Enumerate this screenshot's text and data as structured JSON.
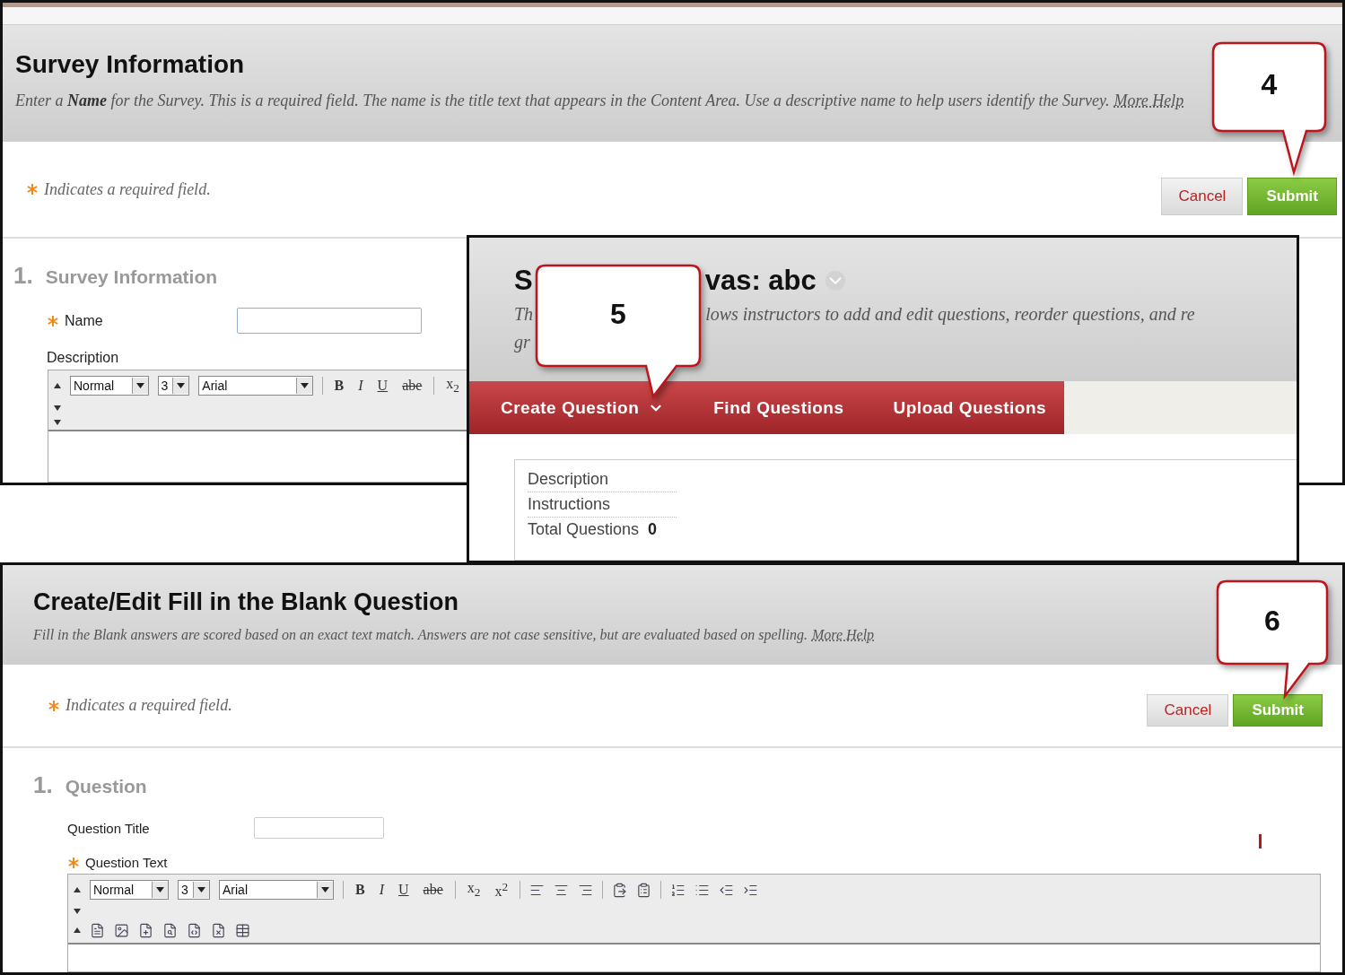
{
  "survey_panel": {
    "title": "Survey Information",
    "description": "Enter a **Name** for the Survey. This is a required field. The name is the title text that appears in the Content Area. Use a descriptive name to help users identify the Survey.",
    "more_help": "More Help",
    "callout": "4",
    "required_note": "Indicates a required field.",
    "buttons": [
      {
        "label": "Cancel",
        "kind": "cancel"
      },
      {
        "label": "Submit",
        "kind": "submit"
      }
    ],
    "section": {
      "number": "1.",
      "title": "Survey Information"
    },
    "fields": [
      {
        "label": "Name",
        "required": true,
        "kind": "input"
      },
      {
        "label": "Description",
        "required": false,
        "kind": "editor"
      }
    ],
    "toolbar": {
      "style": "Normal",
      "size": "3",
      "font": "Arial",
      "format_buttons": [
        "B",
        "I",
        "U",
        "abe",
        "x$_{2}$"
      ]
    }
  },
  "canvas_panel": {
    "title_parts": [
      "S",
      "vas: abc"
    ],
    "description_lines": [
      [
        "Th",
        "lows instructors to add and edit questions, reorder questions, and re"
      ],
      [
        "gr"
      ]
    ],
    "callout": "5",
    "tabs": [
      {
        "label": "Create Question",
        "has_menu": true
      },
      {
        "label": "Find Questions",
        "has_menu": false
      },
      {
        "label": "Upload Questions",
        "has_menu": false
      }
    ],
    "info_rows": [
      {
        "label": "Description"
      },
      {
        "label": "Instructions"
      },
      {
        "label": "Total Questions",
        "value": "0"
      }
    ]
  },
  "question_panel": {
    "title": "Create/Edit Fill in the Blank Question",
    "description": "Fill in the Blank answers are scored based on an exact text match. Answers are not case sensitive, but are evaluated based on spelling.",
    "more_help": "More Help",
    "callout": "6",
    "required_note": "Indicates a required field.",
    "buttons": [
      {
        "label": "Cancel",
        "kind": "cancel"
      },
      {
        "label": "Submit",
        "kind": "submit"
      }
    ],
    "section": {
      "number": "1.",
      "title": "Question"
    },
    "fields": [
      {
        "label": "Question Title",
        "required": false,
        "kind": "input"
      },
      {
        "label": "Question Text",
        "required": true,
        "kind": "editor"
      }
    ],
    "toolbar": {
      "style": "Normal",
      "size": "3",
      "font": "Arial",
      "format_buttons": [
        "B",
        "I",
        "U",
        "abe",
        "x$_{2}$",
        "x$^{2}$"
      ]
    }
  }
}
